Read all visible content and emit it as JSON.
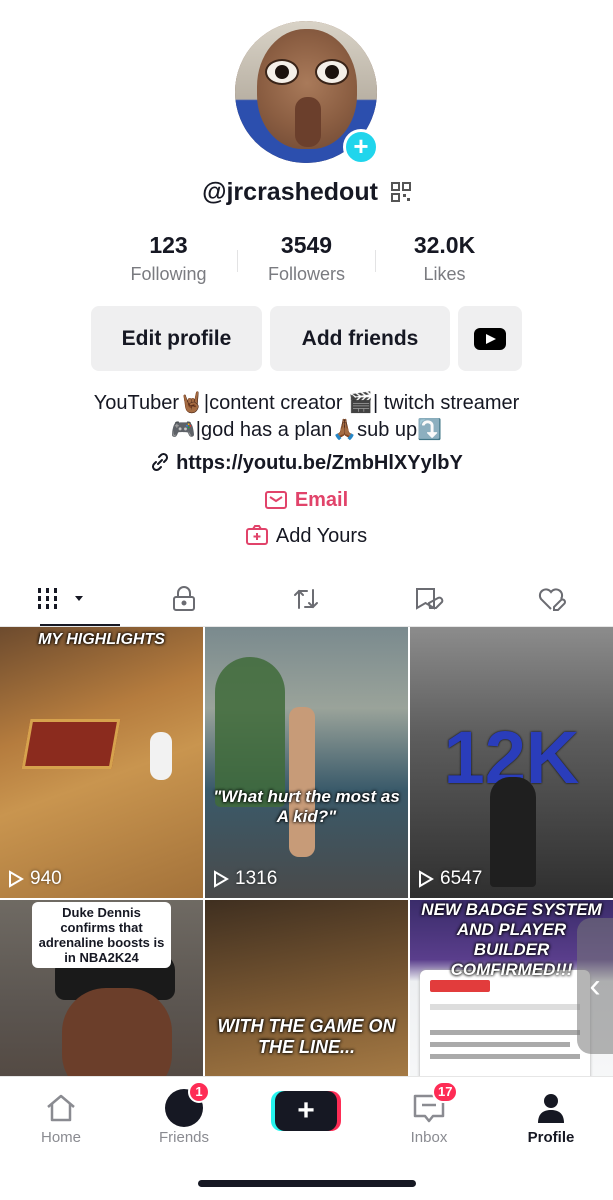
{
  "profile": {
    "username": "@jrcrashedout",
    "stats": [
      {
        "value": "123",
        "label": "Following"
      },
      {
        "value": "3549",
        "label": "Followers"
      },
      {
        "value": "32.0K",
        "label": "Likes"
      }
    ],
    "buttons": {
      "edit": "Edit profile",
      "add_friends": "Add friends"
    },
    "bio_line1": "YouTuber🤘🏾|content creator 🎬|  twitch streamer",
    "bio_line2": "🎮|god has a plan🙏🏾sub up⤵️",
    "link": "https://youtu.be/ZmbHlXYylbY",
    "email_label": "Email",
    "add_yours_label": "Add Yours"
  },
  "tabs": [
    {
      "icon": "grid-icon",
      "active": true
    },
    {
      "icon": "lock-icon"
    },
    {
      "icon": "repost-icon"
    },
    {
      "icon": "saved-icon"
    },
    {
      "icon": "liked-icon"
    }
  ],
  "videos": [
    {
      "caption": "MY HIGHLIGHTS",
      "views": "940"
    },
    {
      "caption": "\"What hurt the most as A kid?\"",
      "views": "1316"
    },
    {
      "caption": "12K",
      "views": "6547"
    },
    {
      "caption": "Duke Dennis confirms that adrenaline boosts is in NBA2K24",
      "views": ""
    },
    {
      "caption": "WITH THE GAME ON THE LINE...",
      "views": ""
    },
    {
      "caption": "NEW BADGE SYSTEM AND PLAYER BUILDER COMFIRMED!!!",
      "views": ""
    }
  ],
  "nav": {
    "home": "Home",
    "friends": "Friends",
    "friends_badge": "1",
    "create": "+",
    "inbox": "Inbox",
    "inbox_badge": "17",
    "profile": "Profile"
  },
  "colors": {
    "accent": "#fe2c55",
    "email": "#e1436a",
    "cyan": "#20d5ec"
  }
}
